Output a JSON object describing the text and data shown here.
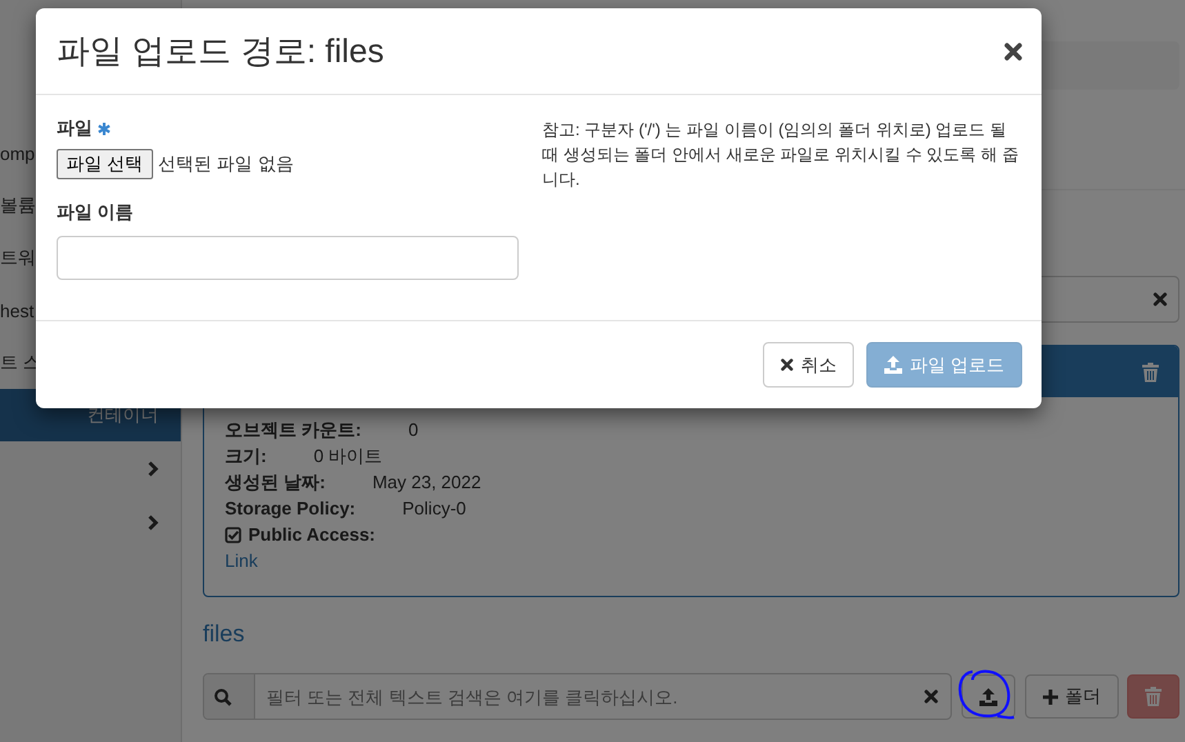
{
  "sidebar": {
    "items": [
      {
        "label": "omp",
        "selected": false
      },
      {
        "label": "볼륨",
        "selected": false
      },
      {
        "label": "트워",
        "selected": false
      },
      {
        "label": "hest",
        "selected": false
      },
      {
        "label": "트 스",
        "selected": false
      },
      {
        "label": "컨테이너",
        "selected": true
      }
    ]
  },
  "container_panel": {
    "details": [
      {
        "label": "오브젝트 카운트:",
        "value": "0"
      },
      {
        "label": "크기:",
        "value": "0 바이트"
      },
      {
        "label": "생성된 날짜:",
        "value": "May 23, 2022"
      },
      {
        "label": "Storage Policy:",
        "value": "Policy-0"
      }
    ],
    "public_access": {
      "label": "Public Access:",
      "checked": true
    },
    "link": "Link"
  },
  "files_heading": "files",
  "toolbar": {
    "search_placeholder": "필터 또는 전체 텍스트 검색은 여기를 클릭하십시오.",
    "folder_button": "폴더"
  },
  "modal": {
    "title": "파일 업로드 경로: files",
    "file_label": "파일",
    "file_required": true,
    "file_button": "파일 선택",
    "file_status": "선택된 파일 없음",
    "name_label": "파일 이름",
    "note": "참고: 구분자 ('/') 는 파일 이름이 (임의의 폴더 위치로) 업로드 될 때 생성되는 폴더 안에서 새로운 파일로 위치시킬 수 있도록 해 줍니다.",
    "cancel_button": "취소",
    "upload_button": {
      "label": "파일 업로드",
      "disabled": true
    }
  }
}
